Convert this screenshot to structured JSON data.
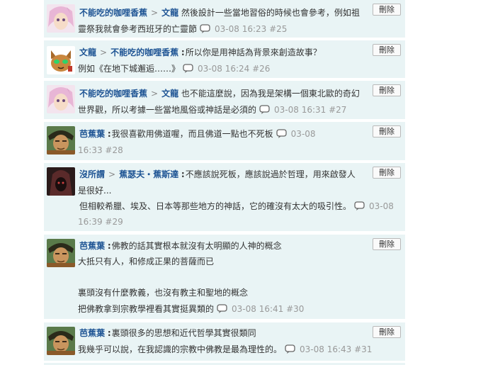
{
  "delete_label": "刪除",
  "replies": [
    {
      "author": "不能吃的咖哩香蕉",
      "target": "文龍",
      "avatar": "avatar-pink-hair-icon",
      "lines": [
        "然後設計一些當地習俗的時候也會參考，例如祖",
        "靈祭我就會參考西班牙的亡靈節"
      ],
      "time": "03-08 16:23",
      "floor": "#25"
    },
    {
      "author": "文龍",
      "target": "不能吃的咖哩香蕉",
      "avatar": "avatar-cat-icon",
      "lines": [
        "所以你是用神話為背景來創造故事？",
        "例如《在地下城邂逅……》"
      ],
      "time": "03-08 16:24",
      "floor": "#26"
    },
    {
      "author": "不能吃的咖哩香蕉",
      "target": "文龍",
      "avatar": "avatar-pink-hair-icon",
      "lines": [
        "也不能這麼說，因為我是架構一個東北歐的奇幻",
        "世界觀，所以考據一些當地風俗或神話是必須的"
      ],
      "time": "03-08 16:31",
      "floor": "#27"
    },
    {
      "author": "芭蕉葉",
      "avatar": "avatar-warrior-icon",
      "lines": [
        "我很喜歡用佛道喔，而且佛道一點也不死板"
      ],
      "time_part1": "03-08",
      "time_part2": "16:33",
      "floor": "#28"
    },
    {
      "author": "沒所謂",
      "target": "蕉瑟夫・蕉斯達",
      "avatar": "avatar-hooded-icon",
      "lines": [
        "不應該說死板，應該說過於哲理，用來啟發人",
        "是很好...",
        "但相較希臘、埃及、日本等那些地方的神話，它的確沒有太大的吸引性。"
      ],
      "time_part1": "03-08",
      "time_part2": "16:39",
      "floor": "#29"
    },
    {
      "author": "芭蕉葉",
      "avatar": "avatar-warrior-icon",
      "lines": [
        "佛教的話其實根本就沒有太明顯的人神的概念",
        "大抵只有人，和修成正果的菩薩而已",
        "",
        "裏頭沒有什麼教義，也沒有教主和聖地的概念",
        "把佛教拿到宗教學裡看其實挺異類的"
      ],
      "time": "03-08 16:41",
      "floor": "#30"
    },
    {
      "author": "芭蕉葉",
      "avatar": "avatar-warrior-icon",
      "lines": [
        "裏頭很多的思想和近代哲學其實很類同",
        "我幾乎可以說，在我認識的宗教中佛教是最為理性的。"
      ],
      "time": "03-08 16:43",
      "floor": "#31"
    }
  ]
}
